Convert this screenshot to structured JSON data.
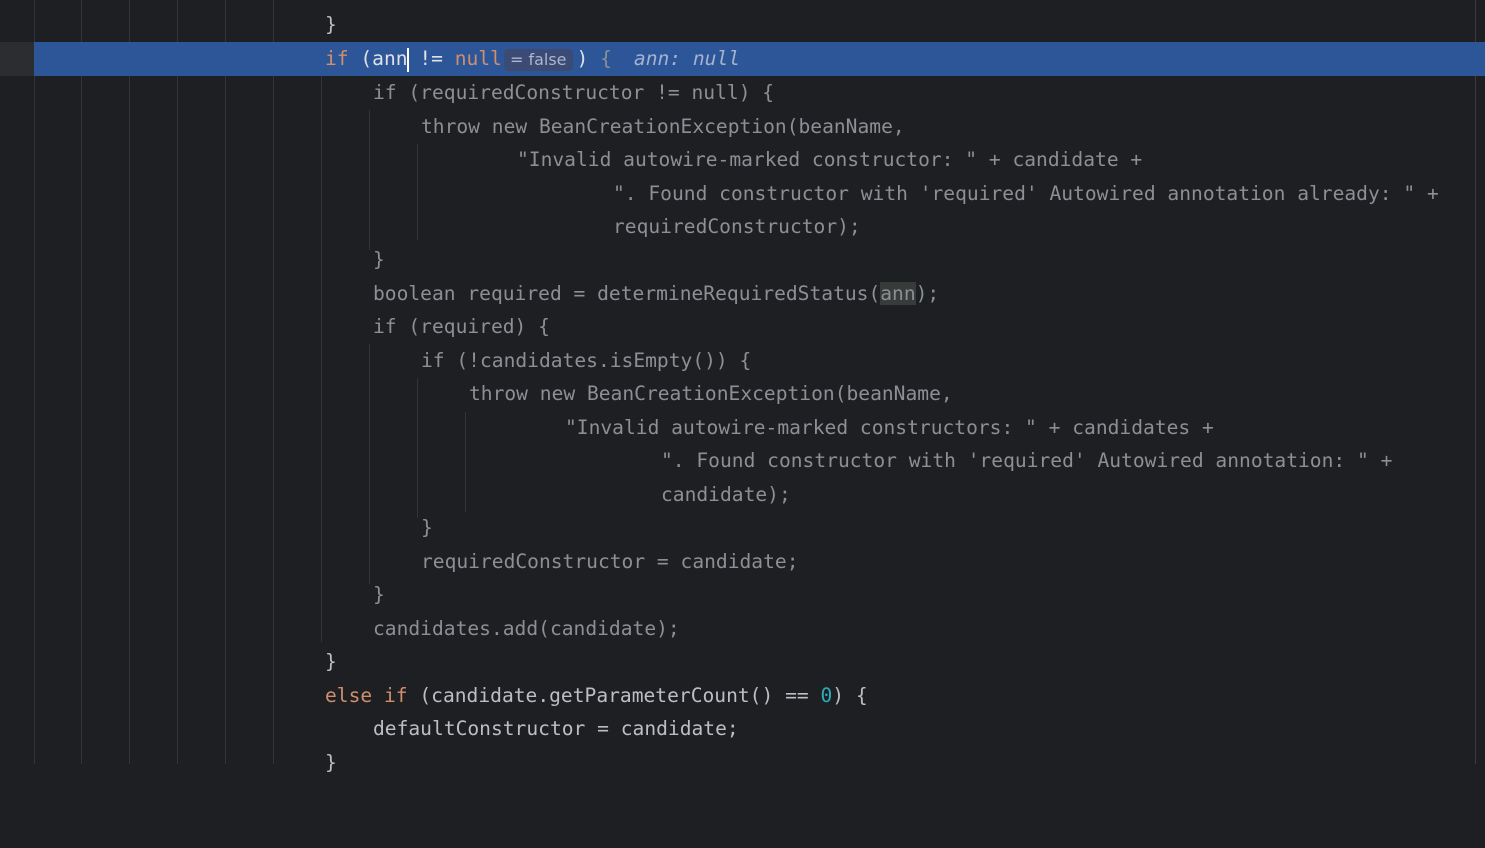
{
  "editor": {
    "inlay_hint": "= false",
    "inline_value": "ann: null"
  },
  "lines": [
    "}",
    "if (ann != null) {",
    "if (requiredConstructor != null) {",
    "throw new BeanCreationException(beanName,",
    "\"Invalid autowire-marked constructor: \" + candidate +",
    "\". Found constructor with 'required' Autowired annotation already: \" +",
    "requiredConstructor);",
    "}",
    "boolean required = determineRequiredStatus(ann);",
    "if (required) {",
    "if (!candidates.isEmpty()) {",
    "throw new BeanCreationException(beanName,",
    "\"Invalid autowire-marked constructors: \" + candidates +",
    "\". Found constructor with 'required' Autowired annotation: \" +",
    "candidate);",
    "}",
    "requiredConstructor = candidate;",
    "}",
    "candidates.add(candidate);",
    "}",
    "else if (candidate.getParameterCount() == 0) {",
    "defaultConstructor = candidate;",
    "}"
  ]
}
